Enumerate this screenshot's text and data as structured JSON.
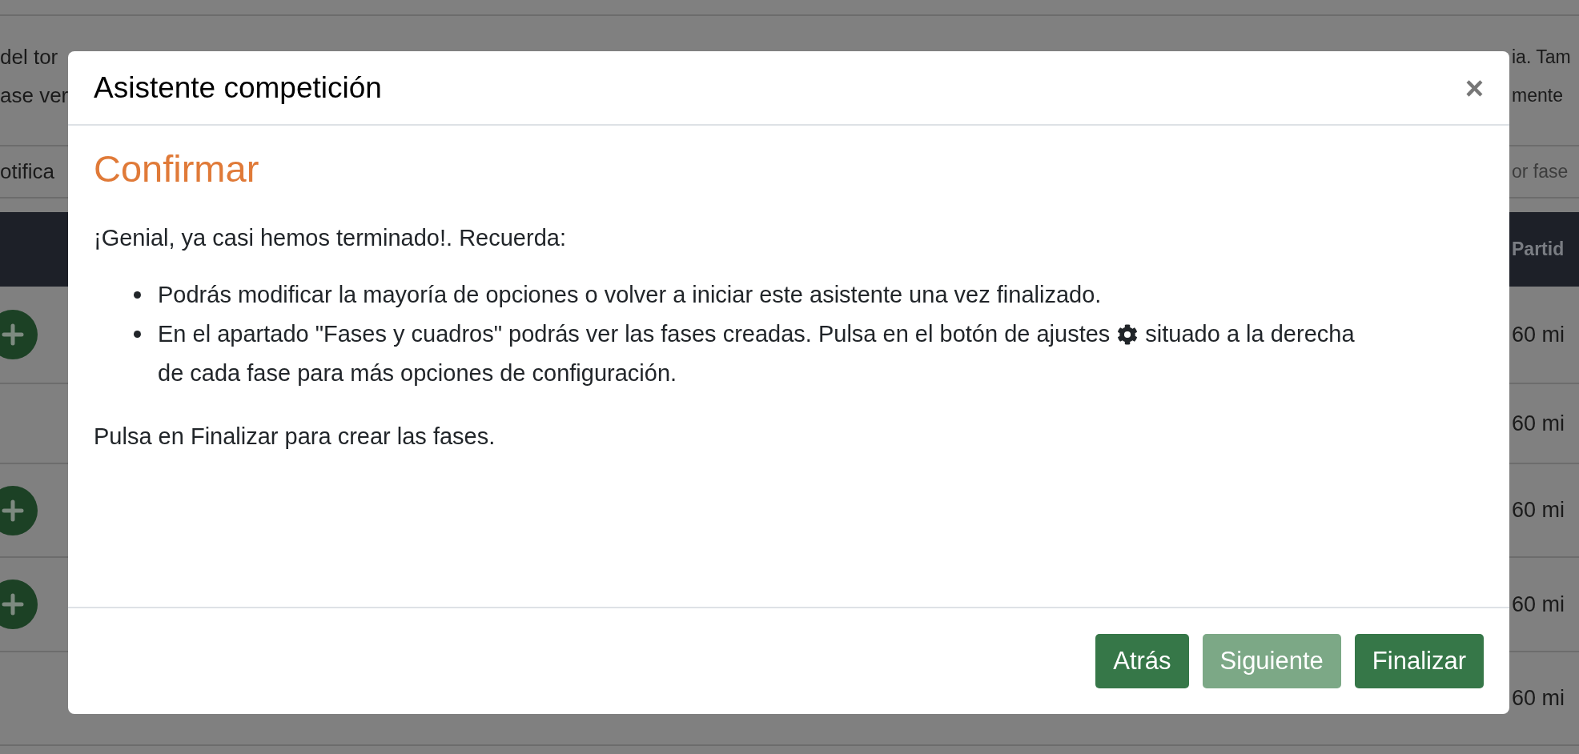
{
  "background": {
    "text_lines": [
      {
        "left": "del tor",
        "right": "ia. Tam"
      },
      {
        "left": "ase ver",
        "right": "mente"
      }
    ],
    "filter_row": {
      "left": "otifica",
      "placeholder": "or fase"
    },
    "table_header": {
      "right": "Partid"
    },
    "table_rows": [
      {
        "add_button": true,
        "duration": "60 mi"
      },
      {
        "add_button": false,
        "duration": "60 mi"
      },
      {
        "add_button": true,
        "duration": "60 mi"
      },
      {
        "add_button": true,
        "duration": "60 mi"
      },
      {
        "add_button": false,
        "duration": "60 mi"
      }
    ]
  },
  "modal": {
    "title": "Asistente competición",
    "close": "×",
    "heading": "Confirmar",
    "intro": "¡Genial, ya casi hemos terminado!. Recuerda:",
    "bullets": [
      {
        "kind": "plain",
        "text": "Podrás modificar la mayoría de opciones o volver a iniciar este asistente una vez finalizado."
      },
      {
        "kind": "with_icon",
        "text": "En el apartado \"Fases y cuadros\" podrás ver las fases creadas. Pulsa en el botón de ajustes",
        "text_after": "situado a la derecha",
        "continuation": "de cada fase para más opciones de configuración."
      }
    ],
    "outro": "Pulsa en Finalizar para crear las fases.",
    "buttons": [
      {
        "label": "Atrás",
        "disabled": false
      },
      {
        "label": "Siguiente",
        "disabled": true
      },
      {
        "label": "Finalizar",
        "disabled": false
      }
    ]
  }
}
